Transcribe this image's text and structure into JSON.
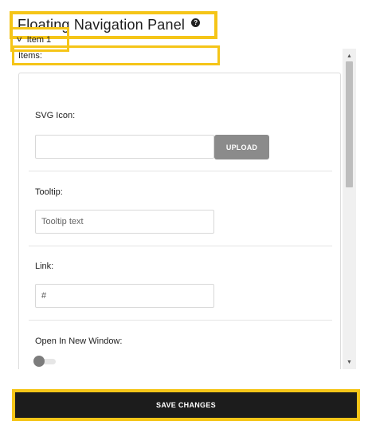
{
  "header": {
    "title": "Floating Navigation Panel",
    "help_icon": "question-circle-icon"
  },
  "items": {
    "label": "Items:"
  },
  "item": {
    "title": "Item 1",
    "expanded": true,
    "svg_icon": {
      "label": "SVG Icon:",
      "value": "",
      "upload_label": "UPLOAD"
    },
    "tooltip": {
      "label": "Tooltip:",
      "placeholder": "Tooltip text",
      "value": ""
    },
    "link": {
      "label": "Link:",
      "value": "#"
    },
    "new_window": {
      "label": "Open In New Window:",
      "enabled": false
    }
  },
  "footer": {
    "save_label": "SAVE CHANGES"
  },
  "colors": {
    "highlight": "#f5c518",
    "save_button_bg": "#1c1c1c",
    "upload_button_bg": "#8b8b8b"
  }
}
